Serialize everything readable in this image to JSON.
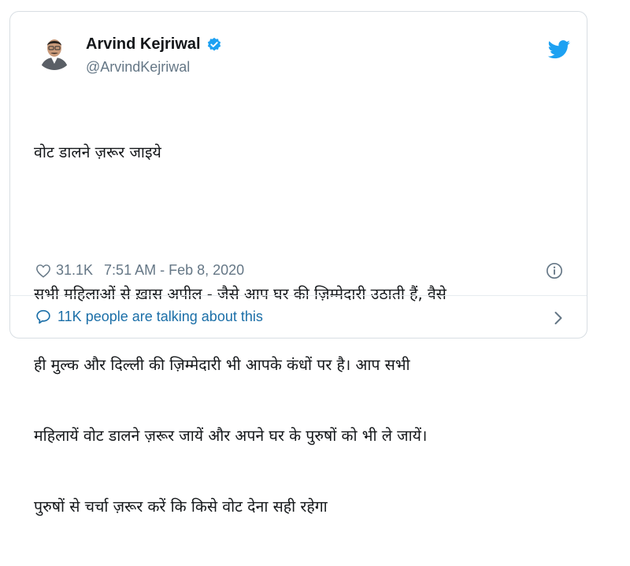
{
  "user": {
    "name": "Arvind Kejriwal",
    "handle": "@ArvindKejriwal",
    "verified_icon": "verified-badge-icon",
    "avatar_icon": "profile-avatar"
  },
  "brand": {
    "icon": "twitter-bird-icon",
    "color": "#1da1f2"
  },
  "tweet": {
    "line1": "वोट डालने ज़रूर जाइये",
    "para2_line1": "सभी महिलाओं से ख़ास अपील - जैसे आप घर की ज़िम्मेदारी उठाती हैं, वैसे",
    "para2_line2": "ही मुल्क और दिल्ली की ज़िम्मेदारी भी आपके कंधों पर है। आप सभी",
    "para2_line3": "महिलायें वोट डालने ज़रूर जायें और अपने घर के पुरुषों को भी ले जायें।",
    "para2_line4": "पुरुषों से चर्चा ज़रूर करें कि किसे वोट देना सही रहेगा"
  },
  "meta": {
    "likes": "31.1K",
    "timestamp": "7:51 AM - Feb 8, 2020",
    "heart_icon": "heart-icon",
    "info_icon": "info-icon"
  },
  "footer": {
    "talking": "11K people are talking about this",
    "bubble_icon": "chat-bubble-icon",
    "chevron_icon": "chevron-right-icon",
    "link_color": "#1b6fa8"
  }
}
